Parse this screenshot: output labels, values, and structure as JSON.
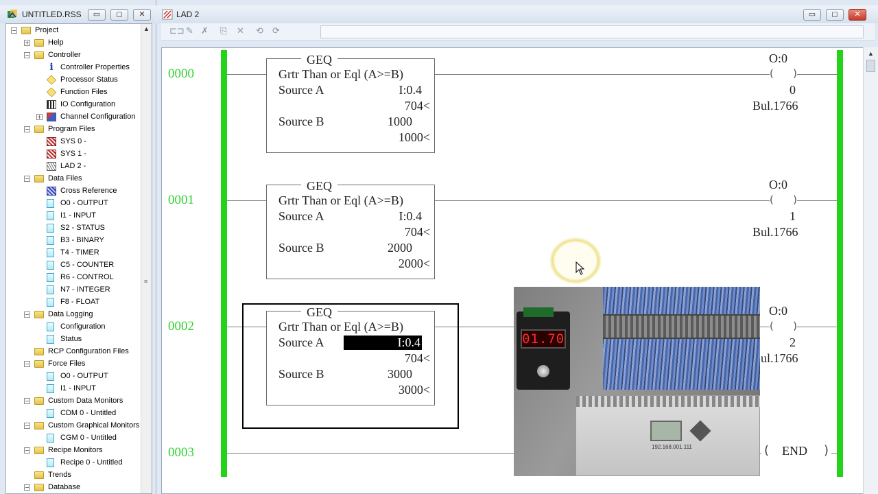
{
  "project_window": {
    "title": "UNTITLED.RSS",
    "buttons": {
      "minimize": "▭",
      "maximize": "◻",
      "close": "✕"
    }
  },
  "tree": [
    {
      "label": "Project",
      "level": 0,
      "icon": "folder",
      "expander": "−"
    },
    {
      "label": "Help",
      "level": 1,
      "icon": "folder",
      "expander": "+"
    },
    {
      "label": "Controller",
      "level": 1,
      "icon": "folder",
      "expander": "−"
    },
    {
      "label": "Controller Properties",
      "level": 2,
      "icon": "info"
    },
    {
      "label": "Processor Status",
      "level": 2,
      "icon": "diamond"
    },
    {
      "label": "Function Files",
      "level": 2,
      "icon": "diamond"
    },
    {
      "label": "IO Configuration",
      "level": 2,
      "icon": "bars"
    },
    {
      "label": "Channel Configuration",
      "level": 2,
      "icon": "chan",
      "expander": "+"
    },
    {
      "label": "Program Files",
      "level": 1,
      "icon": "folder",
      "expander": "−"
    },
    {
      "label": "SYS 0 -",
      "level": 2,
      "icon": "sys"
    },
    {
      "label": "SYS 1 -",
      "level": 2,
      "icon": "sys"
    },
    {
      "label": "LAD 2 -",
      "level": 2,
      "icon": "lad"
    },
    {
      "label": "Data Files",
      "level": 1,
      "icon": "folder",
      "expander": "−"
    },
    {
      "label": "Cross Reference",
      "level": 2,
      "icon": "xref"
    },
    {
      "label": "O0 - OUTPUT",
      "level": 2,
      "icon": "doc"
    },
    {
      "label": "I1 - INPUT",
      "level": 2,
      "icon": "doc"
    },
    {
      "label": "S2 - STATUS",
      "level": 2,
      "icon": "doc"
    },
    {
      "label": "B3 - BINARY",
      "level": 2,
      "icon": "doc"
    },
    {
      "label": "T4 - TIMER",
      "level": 2,
      "icon": "doc"
    },
    {
      "label": "C5 - COUNTER",
      "level": 2,
      "icon": "doc"
    },
    {
      "label": "R6 - CONTROL",
      "level": 2,
      "icon": "doc"
    },
    {
      "label": "N7 - INTEGER",
      "level": 2,
      "icon": "doc"
    },
    {
      "label": "F8 - FLOAT",
      "level": 2,
      "icon": "doc"
    },
    {
      "label": "Data Logging",
      "level": 1,
      "icon": "folder",
      "expander": "−"
    },
    {
      "label": "Configuration",
      "level": 2,
      "icon": "doc"
    },
    {
      "label": "Status",
      "level": 2,
      "icon": "doc"
    },
    {
      "label": "RCP Configuration Files",
      "level": 1,
      "icon": "folder"
    },
    {
      "label": "Force Files",
      "level": 1,
      "icon": "folder",
      "expander": "−"
    },
    {
      "label": "O0 - OUTPUT",
      "level": 2,
      "icon": "doc"
    },
    {
      "label": "I1 - INPUT",
      "level": 2,
      "icon": "doc"
    },
    {
      "label": "Custom Data Monitors",
      "level": 1,
      "icon": "folder",
      "expander": "−"
    },
    {
      "label": "CDM 0 - Untitled",
      "level": 2,
      "icon": "doc"
    },
    {
      "label": "Custom Graphical Monitors",
      "level": 1,
      "icon": "folder",
      "expander": "−"
    },
    {
      "label": "CGM 0 - Untitled",
      "level": 2,
      "icon": "doc"
    },
    {
      "label": "Recipe Monitors",
      "level": 1,
      "icon": "folder",
      "expander": "−"
    },
    {
      "label": "Recipe 0 - Untitled",
      "level": 2,
      "icon": "doc"
    },
    {
      "label": "Trends",
      "level": 1,
      "icon": "folder"
    },
    {
      "label": "Database",
      "level": 1,
      "icon": "folder",
      "expander": "−"
    }
  ],
  "ladder_window": {
    "title": "LAD 2",
    "buttons": {
      "minimize": "▭",
      "maximize": "◻",
      "close": "✕"
    },
    "toolbar_icons": [
      "rung-insert-icon",
      "edit-icon",
      "cancel-edit-icon",
      "accept-icon",
      "delete-icon",
      "test-edits-icon",
      "untest-edits-icon"
    ]
  },
  "rungs": [
    {
      "number": "0000",
      "instruction": {
        "mnemonic": "GEQ",
        "description": "Grtr Than or Eql (A>=B)",
        "source_a_label": "Source A",
        "source_a": "I:0.4",
        "source_a_value": "704<",
        "source_b_label": "Source B",
        "source_b": "1000",
        "source_b_value": "1000<"
      },
      "coil": {
        "address": "O:0",
        "bit": "0",
        "module": "Bul.1766"
      }
    },
    {
      "number": "0001",
      "instruction": {
        "mnemonic": "GEQ",
        "description": "Grtr Than or Eql (A>=B)",
        "source_a_label": "Source A",
        "source_a": "I:0.4",
        "source_a_value": "704<",
        "source_b_label": "Source B",
        "source_b": "2000",
        "source_b_value": "2000<"
      },
      "coil": {
        "address": "O:0",
        "bit": "1",
        "module": "Bul.1766"
      }
    },
    {
      "number": "0002",
      "instruction": {
        "mnemonic": "GEQ",
        "description": "Grtr Than or Eql (A>=B)",
        "source_a_label": "Source A",
        "source_a": "I:0.4",
        "source_a_value": "704<",
        "source_b_label": "Source B",
        "source_b": "3000",
        "source_b_value": "3000<"
      },
      "coil": {
        "address": "O:0",
        "bit": "2",
        "module": "Bul.1766"
      }
    },
    {
      "number": "0003",
      "end_label": "END"
    }
  ],
  "overlay_photo": {
    "meter_reading": "01.70",
    "plc_ip": "192.168.001.111"
  }
}
